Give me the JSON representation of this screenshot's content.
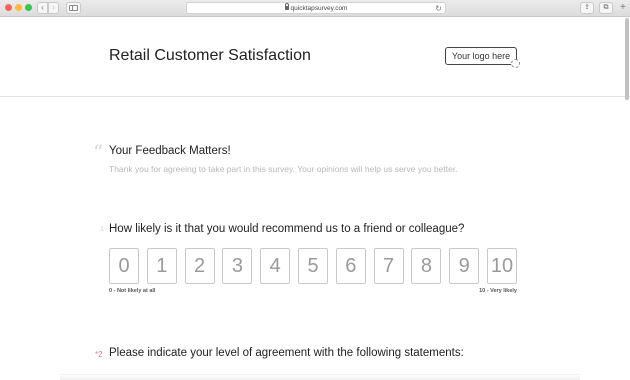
{
  "browser": {
    "url": "quicktapsurvey.com",
    "back_label": "‹",
    "forward_label": "›",
    "reload_label": "↻",
    "share_label": "⇪",
    "tabs_label": "⧉",
    "new_tab_label": "+"
  },
  "header": {
    "title": "Retail Customer Satisfaction",
    "logo_placeholder": "Your logo here"
  },
  "feedback": {
    "quote_icon": "“",
    "title": "Your Feedback Matters!",
    "subtitle": "Thank you for agreeing to take part in this survey. Your opinions will help us serve you better."
  },
  "question1": {
    "number": "1",
    "text": "How likely is it that you would recommend us to a friend or colleague?",
    "scale": [
      "0",
      "1",
      "2",
      "3",
      "4",
      "5",
      "6",
      "7",
      "8",
      "9",
      "10"
    ],
    "low_label": "0 - Not likely at all",
    "high_label": "10 - Very likely"
  },
  "question2": {
    "required_marker": "*2",
    "text": "Please indicate your level of agreement with the following statements:"
  }
}
